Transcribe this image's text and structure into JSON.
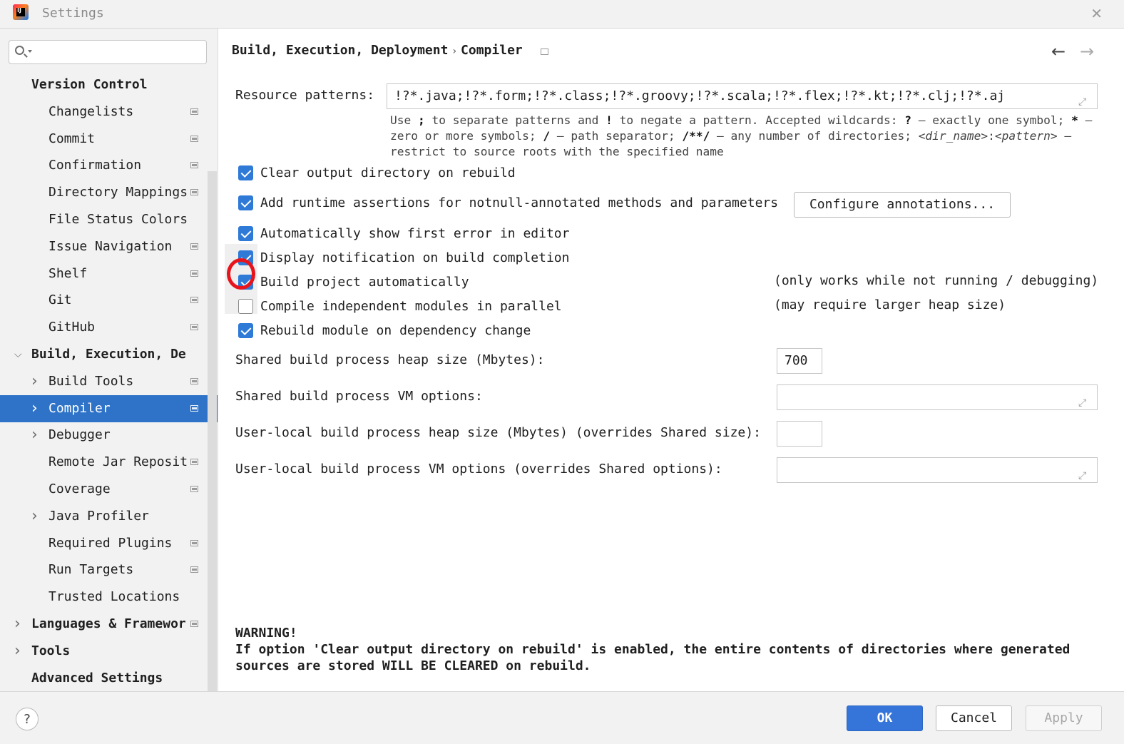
{
  "window": {
    "title": "Settings",
    "close_icon": "close-icon"
  },
  "sidebar": {
    "search": {
      "value": "",
      "placeholder": ""
    },
    "items": [
      {
        "label": "Version Control",
        "level": 0,
        "bold": true,
        "arrow": "",
        "page_icon": false
      },
      {
        "label": "Changelists",
        "level": 1,
        "arrow": "",
        "page_icon": true
      },
      {
        "label": "Commit",
        "level": 1,
        "arrow": "",
        "page_icon": true
      },
      {
        "label": "Confirmation",
        "level": 1,
        "arrow": "",
        "page_icon": true
      },
      {
        "label": "Directory Mappings",
        "level": 1,
        "arrow": "",
        "page_icon": true
      },
      {
        "label": "File Status Colors",
        "level": 1,
        "arrow": "",
        "page_icon": false
      },
      {
        "label": "Issue Navigation",
        "level": 1,
        "arrow": "",
        "page_icon": true
      },
      {
        "label": "Shelf",
        "level": 1,
        "arrow": "",
        "page_icon": true
      },
      {
        "label": "Git",
        "level": 1,
        "arrow": "",
        "page_icon": true
      },
      {
        "label": "GitHub",
        "level": 1,
        "arrow": "",
        "page_icon": true
      },
      {
        "label": "Build, Execution, Depl",
        "level": 0,
        "bold": true,
        "arrow": "expanded",
        "page_icon": false
      },
      {
        "label": "Build Tools",
        "level": 1,
        "arrow": "collapsed",
        "page_icon": true
      },
      {
        "label": "Compiler",
        "level": 1,
        "arrow": "collapsed",
        "page_icon": true,
        "selected": true
      },
      {
        "label": "Debugger",
        "level": 1,
        "arrow": "collapsed",
        "page_icon": false
      },
      {
        "label": "Remote Jar Reposit",
        "level": 1,
        "arrow": "",
        "page_icon": true
      },
      {
        "label": "Coverage",
        "level": 1,
        "arrow": "",
        "page_icon": true
      },
      {
        "label": "Java Profiler",
        "level": 1,
        "arrow": "collapsed",
        "page_icon": false
      },
      {
        "label": "Required Plugins",
        "level": 1,
        "arrow": "",
        "page_icon": true
      },
      {
        "label": "Run Targets",
        "level": 1,
        "arrow": "",
        "page_icon": true
      },
      {
        "label": "Trusted Locations",
        "level": 1,
        "arrow": "",
        "page_icon": false
      },
      {
        "label": "Languages & Framewor",
        "level": 0,
        "bold": true,
        "arrow": "collapsed",
        "page_icon": true
      },
      {
        "label": "Tools",
        "level": 0,
        "bold": true,
        "arrow": "collapsed",
        "page_icon": false
      },
      {
        "label": "Advanced Settings",
        "level": 0,
        "bold": true,
        "arrow": "",
        "page_icon": false
      }
    ]
  },
  "header": {
    "breadcrumb_parent": "Build, Execution, Deployment",
    "breadcrumb_separator": "›",
    "breadcrumb_current": "Compiler",
    "back_icon": "arrow-left-icon",
    "forward_icon": "arrow-right-icon"
  },
  "compiler": {
    "resource_patterns_label": "Resource patterns:",
    "resource_patterns_value": "!?*.java;!?*.form;!?*.class;!?*.groovy;!?*.scala;!?*.flex;!?*.kt;!?*.clj;!?*.aj",
    "hint": {
      "t1": "Use ",
      "b1": ";",
      "t2": " to separate patterns and ",
      "b2": "!",
      "t3": " to negate a pattern. Accepted wildcards: ",
      "b3": "?",
      "t4": " — exactly one symbol; ",
      "b4": "*",
      "t5": " — zero or more symbols; ",
      "b5": "/",
      "t6": " — path separator; ",
      "b6": "/**/",
      "t7": " — any number of directories; ",
      "i1": "<dir_name>",
      "t8": ":",
      "i2": "<pattern>",
      "t9": " — restrict to source roots with the specified name"
    },
    "options": [
      {
        "label": "Clear output directory on rebuild",
        "checked": true
      },
      {
        "label": "Add runtime assertions for notnull-annotated methods and parameters",
        "checked": true
      },
      {
        "label": "Automatically show first error in editor",
        "checked": true
      },
      {
        "label": "Display notification on build completion",
        "checked": true
      },
      {
        "label": "Build project automatically",
        "checked": true
      },
      {
        "label": "Compile independent modules in parallel",
        "checked": false
      },
      {
        "label": "Rebuild module on dependency change",
        "checked": true
      }
    ],
    "configure_annotations_button": "Configure annotations...",
    "note_build_auto": "(only works while not running / debugging)",
    "note_parallel": "(may require larger heap size)",
    "shared_heap_label": "Shared build process heap size (Mbytes):",
    "shared_heap_value": "700",
    "shared_vm_label": "Shared build process VM options:",
    "shared_vm_value": "",
    "user_heap_label": "User-local build process heap size (Mbytes) (overrides Shared size):",
    "user_heap_value": "",
    "user_vm_label": "User-local build process VM options (overrides Shared options):",
    "user_vm_value": "",
    "warning_title": "WARNING!",
    "warning_text": "If option 'Clear output directory on rebuild' is enabled, the entire contents of directories where generated sources are stored WILL BE CLEARED on rebuild."
  },
  "footer": {
    "help_label": "?",
    "ok_label": "OK",
    "cancel_label": "Cancel",
    "apply_label": "Apply"
  },
  "colors": {
    "accent": "#2f73c8",
    "checkbox": "#2f7ad7",
    "annotation_circle": "#e8141c"
  }
}
